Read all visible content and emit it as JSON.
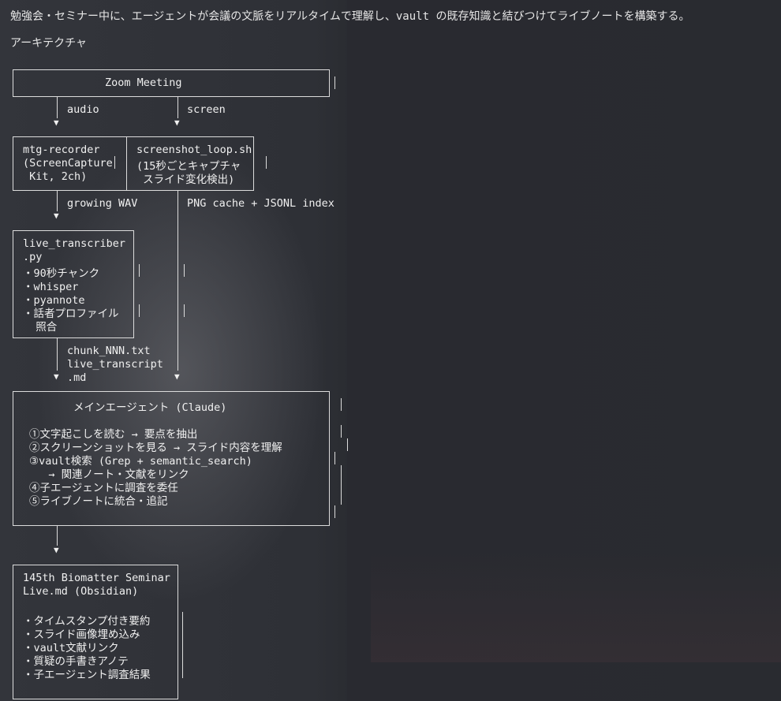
{
  "header": {
    "description": "勉強会・セミナー中に、エージェントが会議の文脈をリアルタイムで理解し、vault の既存知識と結びつけてライブノートを構築する。",
    "section_title": "アーキテクチャ"
  },
  "diagram": {
    "zoom_title": "Zoom Meeting",
    "label_audio": "audio",
    "label_screen": "screen",
    "recorder_lines": [
      "mtg-recorder",
      "(ScreenCapture",
      " Kit, 2ch)"
    ],
    "screenshot_lines": [
      "screenshot_loop.sh",
      "(15秒ごとキャプチャ",
      " スライド変化検出)"
    ],
    "label_growing_wav": "growing WAV",
    "label_png_cache": "PNG cache + JSONL index",
    "transcriber_lines": [
      "live_transcriber",
      ".py",
      "・90秒チャンク",
      "・whisper",
      "・pyannote",
      "・話者プロファイル",
      "  照合"
    ],
    "label_chunk_lines": [
      "chunk_NNN.txt",
      "live_transcript",
      ".md"
    ],
    "agent_title": "メインエージェント (Claude)",
    "agent_lines": [
      "①文字起こしを読む → 要点を抽出",
      "②スクリーンショットを見る → スライド内容を理解",
      "③vault検索 (Grep + semantic_search)",
      "   → 関連ノート・文献をリンク",
      "④子エージェントに調査を委任",
      "⑤ライブノートに統合・追記"
    ],
    "note_lines": [
      "145th Biomatter Seminar",
      "Live.md (Obsidian)",
      "",
      "・タイムスタンプ付き要約",
      "・スライド画像埋め込み",
      "・vault文献リンク",
      "・質疑の手書きアノテ",
      "・子エージェント調査結果"
    ],
    "arrow_glyph": "▼"
  }
}
